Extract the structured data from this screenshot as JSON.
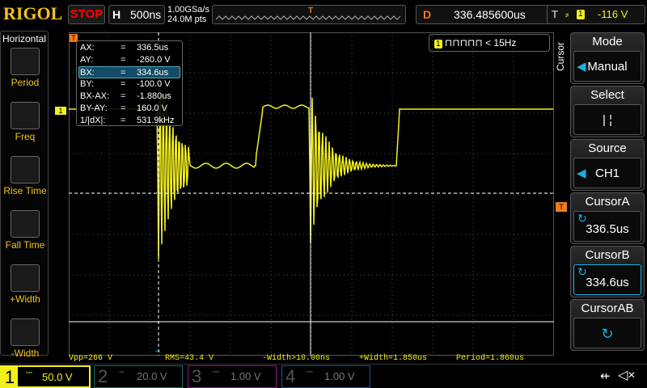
{
  "header": {
    "logo": "RIGOL",
    "run_state": "STOP",
    "h_label": "H",
    "timebase": "500ns",
    "sample_rate": "1.00GSa/s",
    "memory_depth": "24.0M pts",
    "d_label": "D",
    "delay": "336.485600us",
    "t_label": "T",
    "trigger_source": "1",
    "trigger_level": "-116 V"
  },
  "left_menu": {
    "title": "Horizontal",
    "items": [
      {
        "label": "Period",
        "icon": "period-icon"
      },
      {
        "label": "Freq",
        "icon": "freq-icon"
      },
      {
        "label": "Rise Time",
        "icon": "rise-time-icon"
      },
      {
        "label": "Fall Time",
        "icon": "fall-time-icon"
      },
      {
        "label": "+Width",
        "icon": "pos-width-icon"
      },
      {
        "label": "-Width",
        "icon": "neg-width-icon"
      }
    ]
  },
  "cursor_readout": [
    {
      "k": "AX:",
      "v": "336.5us"
    },
    {
      "k": "AY:",
      "v": "-260.0 V"
    },
    {
      "k": "BX:",
      "v": "334.6us"
    },
    {
      "k": "BY:",
      "v": "-100.0 V"
    },
    {
      "k": "BX-AX:",
      "v": "-1.880us"
    },
    {
      "k": "BY-AY:",
      "v": "160.0 V"
    },
    {
      "k": "1/|dX|:",
      "v": "531.9kHz"
    }
  ],
  "cursor_eq": "=",
  "frequency_counter": {
    "channel": "1",
    "value": "< 15Hz"
  },
  "ch1_marker": "1",
  "trigger_marker": "T",
  "measurements": [
    "Vpp=266 V",
    "RMS=43.4 V",
    "-Width>10.00ns",
    "+Width=1.850us",
    "Period=1.860us"
  ],
  "right_menu": {
    "title": "Cursor",
    "items": [
      {
        "label": "Mode",
        "value": "Manual"
      },
      {
        "label": "Select",
        "value": "|  ¦"
      },
      {
        "label": "Source",
        "value": "CH1"
      },
      {
        "label": "CursorA",
        "value": "336.5us"
      },
      {
        "label": "CursorB",
        "value": "334.6us"
      },
      {
        "label": "CursorAB",
        "value": ""
      }
    ]
  },
  "channels": [
    {
      "num": "1",
      "coupling": "⎓",
      "scale": "50.0 V",
      "color": "#f3f01c",
      "active": true
    },
    {
      "num": "2",
      "coupling": "~",
      "scale": "20.0 V",
      "color": "#0f6f6a"
    },
    {
      "num": "3",
      "coupling": "⎓",
      "scale": "1.00 V",
      "color": "#8a1a8a"
    },
    {
      "num": "4",
      "coupling": "⎓",
      "scale": "1.00 V",
      "color": "#1f4f8f"
    }
  ],
  "colors": {
    "ch1": "#f3f01c",
    "accent": "#1ab0e0",
    "trigger": "#f07b1c"
  }
}
